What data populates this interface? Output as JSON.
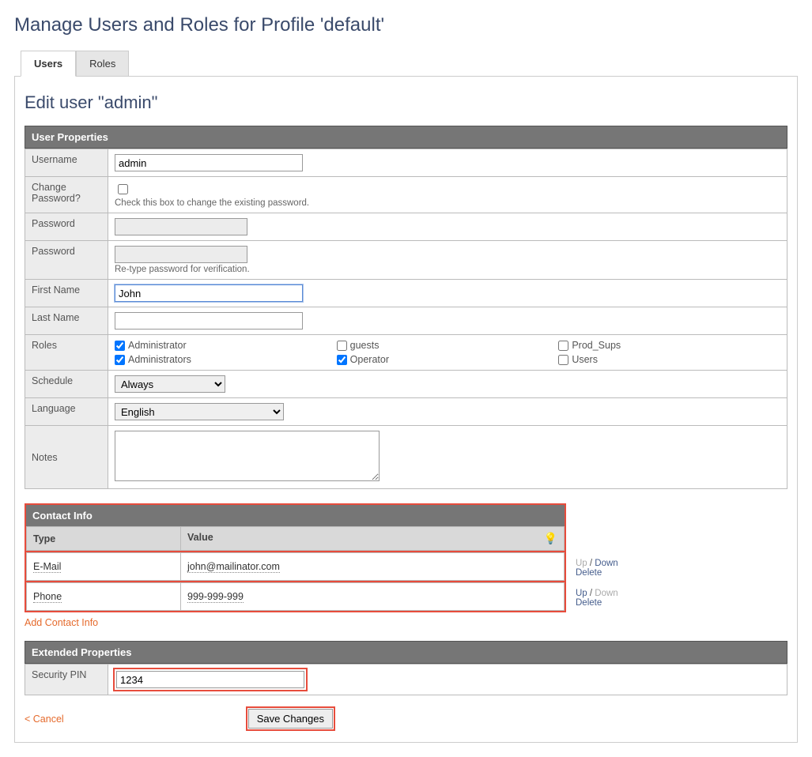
{
  "page": {
    "title": "Manage Users and Roles for Profile 'default'"
  },
  "tabs": {
    "users": "Users",
    "roles": "Roles"
  },
  "editTitle": "Edit user \"admin\"",
  "sections": {
    "userProps": "User Properties",
    "contactInfo": "Contact Info",
    "extended": "Extended Properties"
  },
  "labels": {
    "username": "Username",
    "changePassword": "Change Password?",
    "password": "Password",
    "firstName": "First Name",
    "lastName": "Last Name",
    "roles": "Roles",
    "schedule": "Schedule",
    "language": "Language",
    "notes": "Notes",
    "securityPin": "Security PIN"
  },
  "help": {
    "changePassword": "Check this box to change the existing password.",
    "retype": "Re-type password for verification."
  },
  "values": {
    "username": "admin",
    "firstName": "John",
    "lastName": "",
    "schedule": "Always",
    "language": "English",
    "notes": "",
    "securityPin": "1234"
  },
  "roles": [
    {
      "label": "Administrator",
      "checked": true
    },
    {
      "label": "guests",
      "checked": false
    },
    {
      "label": "Prod_Sups",
      "checked": false
    },
    {
      "label": "Administrators",
      "checked": true
    },
    {
      "label": "Operator",
      "checked": true
    },
    {
      "label": "Users",
      "checked": false
    }
  ],
  "contact": {
    "headers": {
      "type": "Type",
      "value": "Value"
    },
    "rows": [
      {
        "type": "E-Mail",
        "value": "john@mailinator.com"
      },
      {
        "type": "Phone",
        "value": "999-999-999"
      }
    ],
    "actions": {
      "up": "Up",
      "down": "Down",
      "delete": "Delete",
      "sep": " / "
    },
    "addLink": "Add Contact Info",
    "bulbIcon": "💡"
  },
  "footer": {
    "cancel": "<  Cancel",
    "save": "Save Changes"
  }
}
